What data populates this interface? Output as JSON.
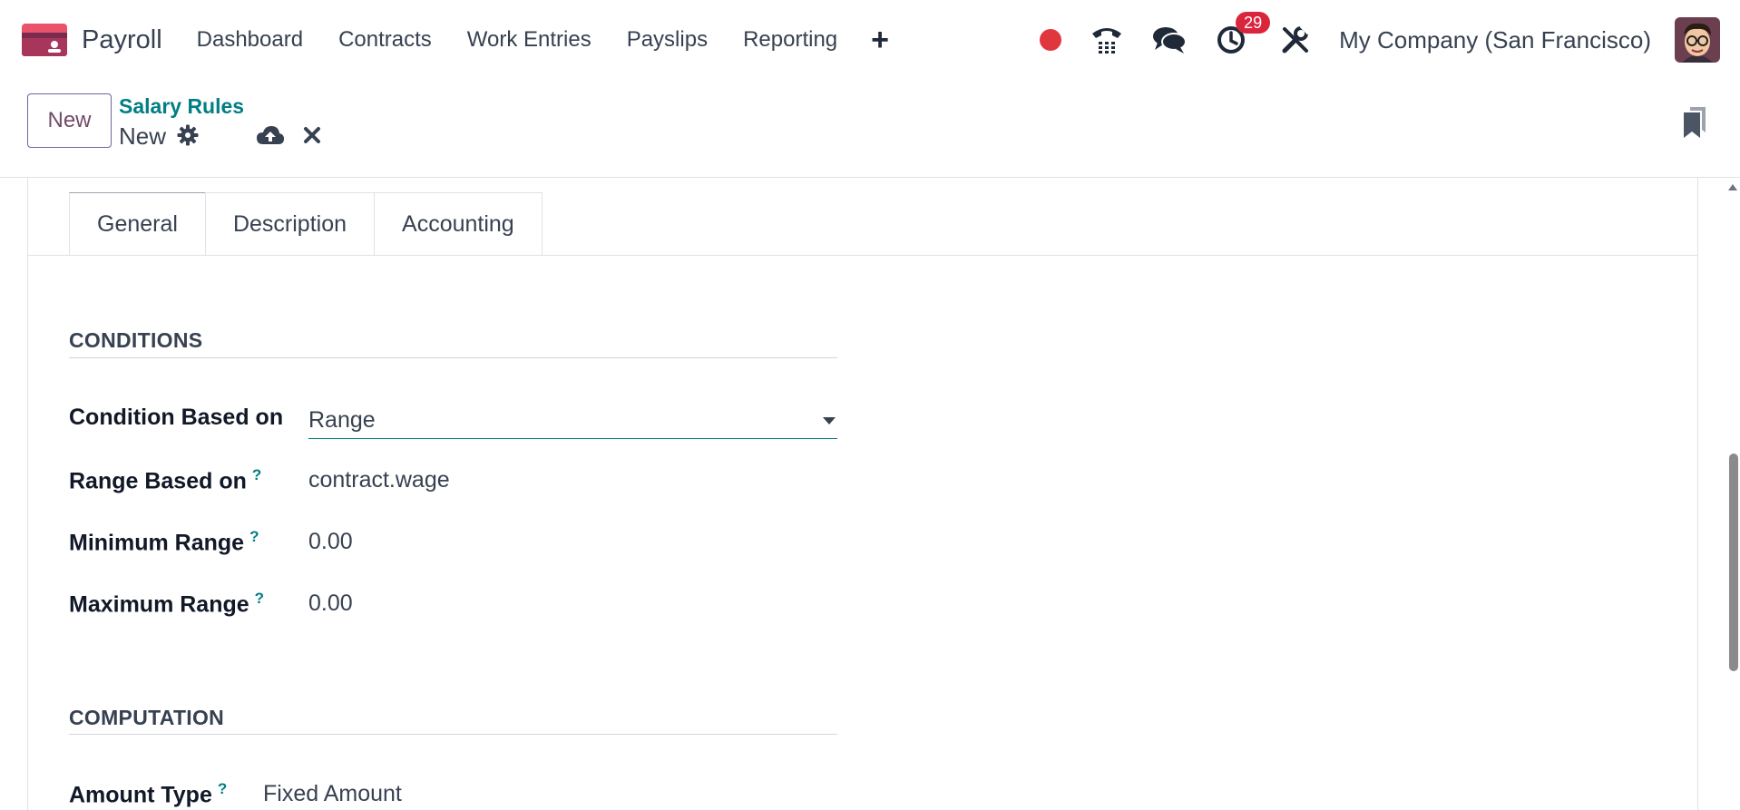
{
  "nav": {
    "app_name": "Payroll",
    "menu": [
      "Dashboard",
      "Contracts",
      "Work Entries",
      "Payslips",
      "Reporting"
    ],
    "plus": "+",
    "activity_count": "29",
    "company": "My Company (San Francisco)"
  },
  "control": {
    "new_label": "New",
    "breadcrumb": "Salary Rules",
    "current": "New"
  },
  "tabs": [
    "General",
    "Description",
    "Accounting"
  ],
  "conditions": {
    "title": "CONDITIONS",
    "condition_based_on_label": "Condition Based on",
    "condition_based_on_value": "Range",
    "range_based_on_label": "Range Based on",
    "range_based_on_value": "contract.wage",
    "min_range_label": "Minimum Range",
    "min_range_value": "0.00",
    "max_range_label": "Maximum Range",
    "max_range_value": "0.00"
  },
  "computation": {
    "title": "COMPUTATION",
    "amount_type_label": "Amount Type",
    "amount_type_value": "Fixed Amount"
  },
  "help_mark": "?",
  "colors": {
    "brand": "#714b67",
    "accent": "#017e84",
    "badge": "#d9263d",
    "record": "#e0373f"
  }
}
